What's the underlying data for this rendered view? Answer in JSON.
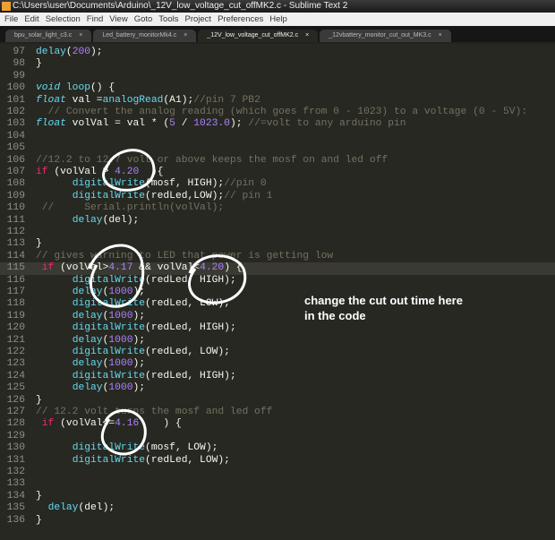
{
  "window": {
    "title": "C:\\Users\\user\\Documents\\Arduino\\_12V_low_voltage_cut_offMK2.c - Sublime Text 2"
  },
  "menu": [
    "File",
    "Edit",
    "Selection",
    "Find",
    "View",
    "Goto",
    "Tools",
    "Project",
    "Preferences",
    "Help"
  ],
  "tabs": [
    {
      "label": "bpu_solar_light_c3.c",
      "active": false
    },
    {
      "label": "Led_battery_monitorMk4.c",
      "active": false
    },
    {
      "label": "_12V_low_voltage_cut_offMK2.c",
      "active": true
    },
    {
      "label": "_12vbattery_monitor_cut_out_MK3.c",
      "active": false
    }
  ],
  "tab_close": "×",
  "current_line": 115,
  "code": [
    {
      "n": 97,
      "t": [
        [
          "fn",
          "delay"
        ],
        [
          "tx",
          "("
        ],
        [
          "num",
          "200"
        ],
        [
          "tx",
          ");"
        ]
      ]
    },
    {
      "n": 98,
      "t": [
        [
          "tx",
          "}"
        ]
      ]
    },
    {
      "n": 99,
      "t": []
    },
    {
      "n": 100,
      "t": [
        [
          "ty",
          "void"
        ],
        [
          "tx",
          " "
        ],
        [
          "fn",
          "loop"
        ],
        [
          "tx",
          "() {"
        ]
      ]
    },
    {
      "n": 101,
      "t": [
        [
          "ty",
          "float"
        ],
        [
          "tx",
          " val ="
        ],
        [
          "fn",
          "analogRead"
        ],
        [
          "tx",
          "(A1);"
        ],
        [
          "cm",
          "//pin 7 PB2"
        ]
      ]
    },
    {
      "n": 102,
      "t": [
        [
          "cm",
          "  // Convert the analog reading (which goes from 0 - 1023) to a voltage (0 - 5V):"
        ]
      ]
    },
    {
      "n": 103,
      "t": [
        [
          "ty",
          "float"
        ],
        [
          "tx",
          " volVal = val * ("
        ],
        [
          "num",
          "5"
        ],
        [
          "tx",
          " / "
        ],
        [
          "num",
          "1023.0"
        ],
        [
          "tx",
          "); "
        ],
        [
          "cm",
          "//=volt to any arduino pin"
        ]
      ]
    },
    {
      "n": 104,
      "t": []
    },
    {
      "n": 105,
      "t": []
    },
    {
      "n": 106,
      "t": [
        [
          "cm",
          "//12.2 to 12.7 volt or above keeps the mosf on and led off"
        ]
      ]
    },
    {
      "n": 107,
      "t": [
        [
          "kw",
          "if"
        ],
        [
          "tx",
          " (volVal > "
        ],
        [
          "num",
          "4.20"
        ],
        [
          "tx",
          "  ){"
        ]
      ]
    },
    {
      "n": 108,
      "t": [
        [
          "tx",
          "      "
        ],
        [
          "fn",
          "digitalWrite"
        ],
        [
          "tx",
          "(mosf, HIGH);"
        ],
        [
          "cm",
          "//pin 0"
        ]
      ]
    },
    {
      "n": 109,
      "t": [
        [
          "tx",
          "      "
        ],
        [
          "fn",
          "digitalWrite"
        ],
        [
          "tx",
          "(redLed,LOW);"
        ],
        [
          "cm",
          "// pin 1"
        ]
      ]
    },
    {
      "n": 110,
      "t": [
        [
          "cm",
          " //     Serial.println(volVal);"
        ]
      ]
    },
    {
      "n": 111,
      "t": [
        [
          "tx",
          "      "
        ],
        [
          "fn",
          "delay"
        ],
        [
          "tx",
          "(del);"
        ]
      ]
    },
    {
      "n": 112,
      "t": []
    },
    {
      "n": 113,
      "t": [
        [
          "tx",
          "}"
        ]
      ]
    },
    {
      "n": 114,
      "t": [
        [
          "cm",
          "// gives warning to LED that power is getting low"
        ]
      ]
    },
    {
      "n": 115,
      "t": [
        [
          "tx",
          " "
        ],
        [
          "kw",
          "if"
        ],
        [
          "tx",
          " (volVal>"
        ],
        [
          "num",
          "4.17"
        ],
        [
          "tx",
          " && volVal<"
        ],
        [
          "num",
          "4.20"
        ],
        [
          "tx",
          ") {"
        ]
      ]
    },
    {
      "n": 116,
      "t": [
        [
          "tx",
          "      "
        ],
        [
          "fn",
          "digitalWrite"
        ],
        [
          "tx",
          "(redLed, HIGH);"
        ]
      ]
    },
    {
      "n": 117,
      "t": [
        [
          "tx",
          "      "
        ],
        [
          "fn",
          "delay"
        ],
        [
          "tx",
          "("
        ],
        [
          "num",
          "1000"
        ],
        [
          "tx",
          ");"
        ]
      ]
    },
    {
      "n": 118,
      "t": [
        [
          "tx",
          "      "
        ],
        [
          "fn",
          "digitalWrite"
        ],
        [
          "tx",
          "(redLed, LOW);"
        ]
      ]
    },
    {
      "n": 119,
      "t": [
        [
          "tx",
          "      "
        ],
        [
          "fn",
          "delay"
        ],
        [
          "tx",
          "("
        ],
        [
          "num",
          "1000"
        ],
        [
          "tx",
          ");"
        ]
      ]
    },
    {
      "n": 120,
      "t": [
        [
          "tx",
          "      "
        ],
        [
          "fn",
          "digitalWrite"
        ],
        [
          "tx",
          "(redLed, HIGH);"
        ]
      ]
    },
    {
      "n": 121,
      "t": [
        [
          "tx",
          "      "
        ],
        [
          "fn",
          "delay"
        ],
        [
          "tx",
          "("
        ],
        [
          "num",
          "1000"
        ],
        [
          "tx",
          ");"
        ]
      ]
    },
    {
      "n": 122,
      "t": [
        [
          "tx",
          "      "
        ],
        [
          "fn",
          "digitalWrite"
        ],
        [
          "tx",
          "(redLed, LOW);"
        ]
      ]
    },
    {
      "n": 123,
      "t": [
        [
          "tx",
          "      "
        ],
        [
          "fn",
          "delay"
        ],
        [
          "tx",
          "("
        ],
        [
          "num",
          "1000"
        ],
        [
          "tx",
          ");"
        ]
      ]
    },
    {
      "n": 124,
      "t": [
        [
          "tx",
          "      "
        ],
        [
          "fn",
          "digitalWrite"
        ],
        [
          "tx",
          "(redLed, HIGH);"
        ]
      ]
    },
    {
      "n": 125,
      "t": [
        [
          "tx",
          "      "
        ],
        [
          "fn",
          "delay"
        ],
        [
          "tx",
          "("
        ],
        [
          "num",
          "1000"
        ],
        [
          "tx",
          ");"
        ]
      ]
    },
    {
      "n": 126,
      "t": [
        [
          "tx",
          "}"
        ]
      ]
    },
    {
      "n": 127,
      "t": [
        [
          "cm",
          "// 12.2 volt turns the mosf and led off"
        ]
      ]
    },
    {
      "n": 128,
      "t": [
        [
          "tx",
          " "
        ],
        [
          "kw",
          "if"
        ],
        [
          "tx",
          " (volVal<="
        ],
        [
          "num",
          "4.16"
        ],
        [
          "tx",
          "    ) {"
        ]
      ]
    },
    {
      "n": 129,
      "t": []
    },
    {
      "n": 130,
      "t": [
        [
          "tx",
          "      "
        ],
        [
          "fn",
          "digitalWrite"
        ],
        [
          "tx",
          "(mosf, LOW);"
        ]
      ]
    },
    {
      "n": 131,
      "t": [
        [
          "tx",
          "      "
        ],
        [
          "fn",
          "digitalWrite"
        ],
        [
          "tx",
          "(redLed, LOW);"
        ]
      ]
    },
    {
      "n": 132,
      "t": []
    },
    {
      "n": 133,
      "t": []
    },
    {
      "n": 134,
      "t": [
        [
          "tx",
          "}"
        ]
      ]
    },
    {
      "n": 135,
      "t": [
        [
          "tx",
          "  "
        ],
        [
          "fn",
          "delay"
        ],
        [
          "tx",
          "(del);"
        ]
      ]
    },
    {
      "n": 136,
      "t": [
        [
          "tx",
          "}"
        ]
      ]
    }
  ],
  "annotation": {
    "line1": "change the cut out time here",
    "line2": "in the code"
  }
}
